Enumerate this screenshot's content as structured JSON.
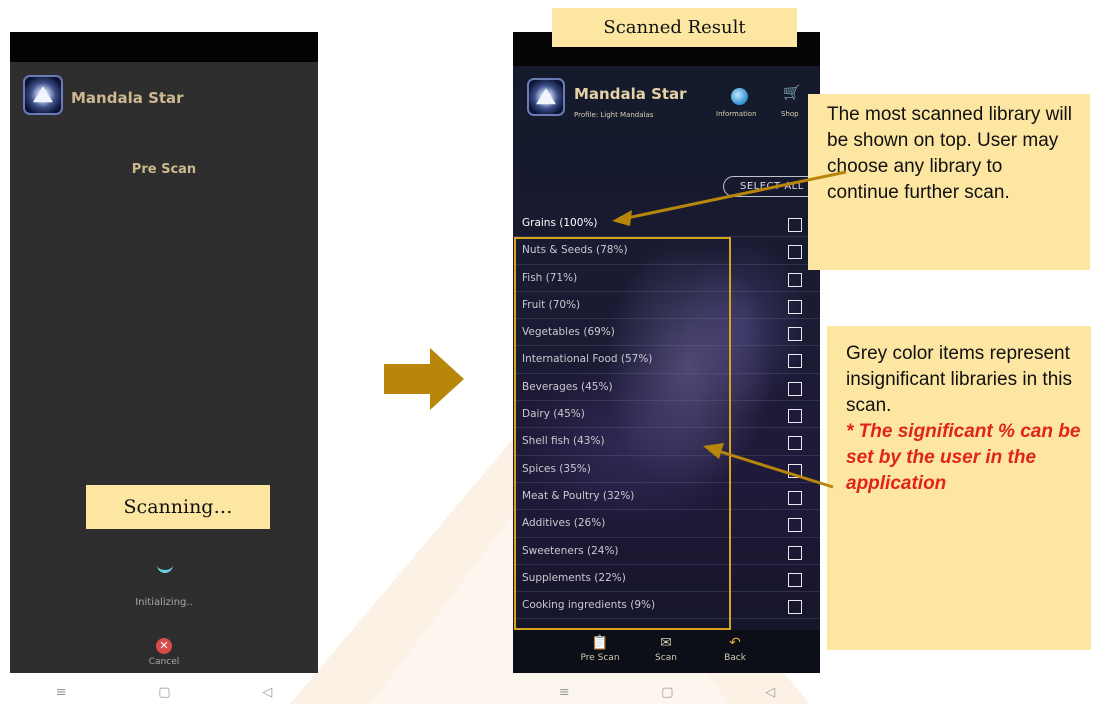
{
  "left_phone": {
    "app_title": "Mandala Star",
    "screen_title": "Pre Scan",
    "status": "Initializing..",
    "cancel_label": "Cancel"
  },
  "callouts": {
    "scanning": "Scanning…",
    "scanned_result": "Scanned Result",
    "library_note": "The most scanned library will be shown on top. User may choose any library to continue further scan.",
    "grey_note": "Grey color items represent insignificant libraries in this scan.",
    "significant_note": "* The significant % can be set by the user in the application"
  },
  "right_phone": {
    "app_title": "Mandala Star",
    "profile": "Profile: Light Mandalas",
    "information_label": "Information",
    "shop_label": "Shop",
    "select_all": "SELECT ALL",
    "libraries": [
      {
        "label": "Grains (100%)",
        "significant": true
      },
      {
        "label": "Nuts & Seeds (78%)",
        "significant": false
      },
      {
        "label": "Fish (71%)",
        "significant": false
      },
      {
        "label": "Fruit (70%)",
        "significant": false
      },
      {
        "label": "Vegetables (69%)",
        "significant": false
      },
      {
        "label": "International Food (57%)",
        "significant": false
      },
      {
        "label": "Beverages (45%)",
        "significant": false
      },
      {
        "label": "Dairy (45%)",
        "significant": false
      },
      {
        "label": "Shell fish (43%)",
        "significant": false
      },
      {
        "label": "Spices (35%)",
        "significant": false
      },
      {
        "label": "Meat & Poultry (32%)",
        "significant": false
      },
      {
        "label": "Additives (26%)",
        "significant": false
      },
      {
        "label": "Sweeteners (24%)",
        "significant": false
      },
      {
        "label": "Supplements (22%)",
        "significant": false
      },
      {
        "label": "Cooking ingredients (9%)",
        "significant": false
      }
    ],
    "nav": {
      "pre_scan": "Pre Scan",
      "scan": "Scan",
      "back": "Back"
    }
  },
  "system_nav": {
    "menu": "≡",
    "home": "▢",
    "back": "◁"
  },
  "colors": {
    "callout_bg": "#fde6a2",
    "highlight_border": "#d9a320",
    "arrow": "#b8860b",
    "note_red": "#e1241b"
  }
}
